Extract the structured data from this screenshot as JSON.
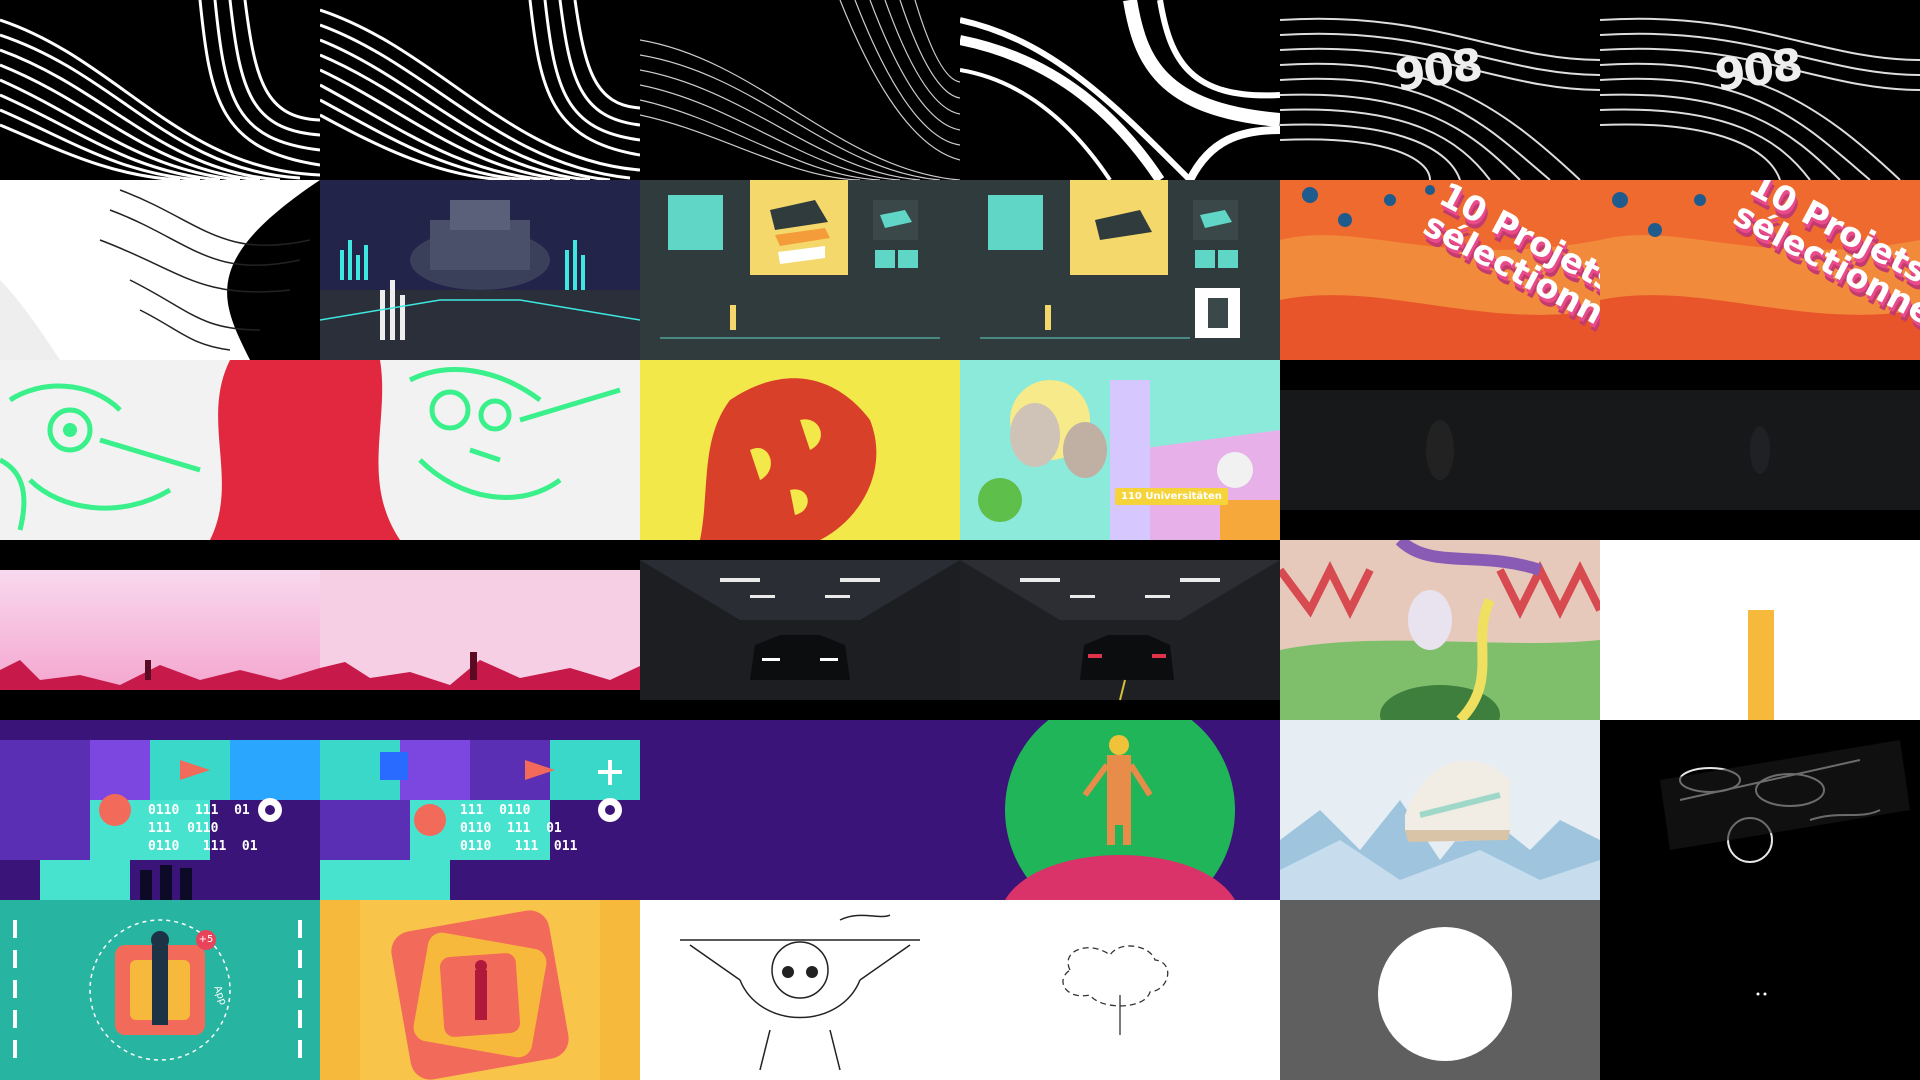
{
  "logo_text": "908",
  "projects_text_line1": "10 Projets",
  "projects_text_line2": "sélectionnés",
  "tag_text": "110 Universitäten",
  "binary_lines": "0110  111  01\n111  0110\n0110   111  01",
  "binary_lines_b": "111  0110\n0110  111  01\n0110   111  011",
  "badge_text": "+5",
  "dial_text": "App",
  "colors": {
    "teal_dark": "#2f3b3c",
    "yellow": "#f5d86b",
    "orange": "#ef6a2e",
    "green_neon": "#39f08a",
    "red": "#e2283f",
    "purple": "#3a1478",
    "teal": "#27b4a0",
    "amber": "#f7b93c",
    "grey": "#5f5f5f"
  }
}
